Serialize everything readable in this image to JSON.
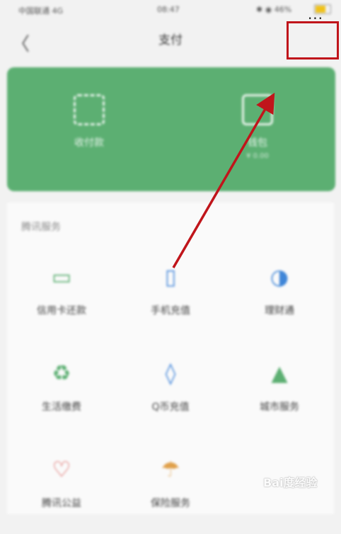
{
  "status": {
    "carrier": "中国联通 4G",
    "time": "08:47",
    "right": "✱ ◉ 46%"
  },
  "nav": {
    "back_glyph": "〈",
    "title": "支付",
    "more_glyph": "···"
  },
  "card": {
    "items": [
      {
        "label": "收付款",
        "sub": ""
      },
      {
        "label": "钱包",
        "sub": "¥ 0.00"
      }
    ]
  },
  "services": {
    "section_title": "腾讯服务",
    "items": [
      {
        "label": "信用卡还款",
        "icon": "card-icon",
        "glyph": "▭",
        "color": "#5caf72"
      },
      {
        "label": "手机充值",
        "icon": "phone-icon",
        "glyph": "▯",
        "color": "#4a8bdc"
      },
      {
        "label": "理财通",
        "icon": "finance-icon",
        "glyph": "◑",
        "color": "#3f86d8"
      },
      {
        "label": "生活缴费",
        "icon": "utility-icon",
        "glyph": "♻",
        "color": "#5caf72"
      },
      {
        "label": "Q币充值",
        "icon": "drop-icon",
        "glyph": "◊",
        "color": "#4a8bdc"
      },
      {
        "label": "城市服务",
        "icon": "city-icon",
        "glyph": "▲",
        "color": "#5caf72"
      },
      {
        "label": "腾讯公益",
        "icon": "heart-icon",
        "glyph": "♡",
        "color": "#d9534f"
      },
      {
        "label": "保险服务",
        "icon": "umbrella-icon",
        "glyph": "☂",
        "color": "#e0a04a"
      }
    ]
  },
  "watermark": {
    "text": "Bai度经验"
  },
  "annotation_color": "#c0151b"
}
